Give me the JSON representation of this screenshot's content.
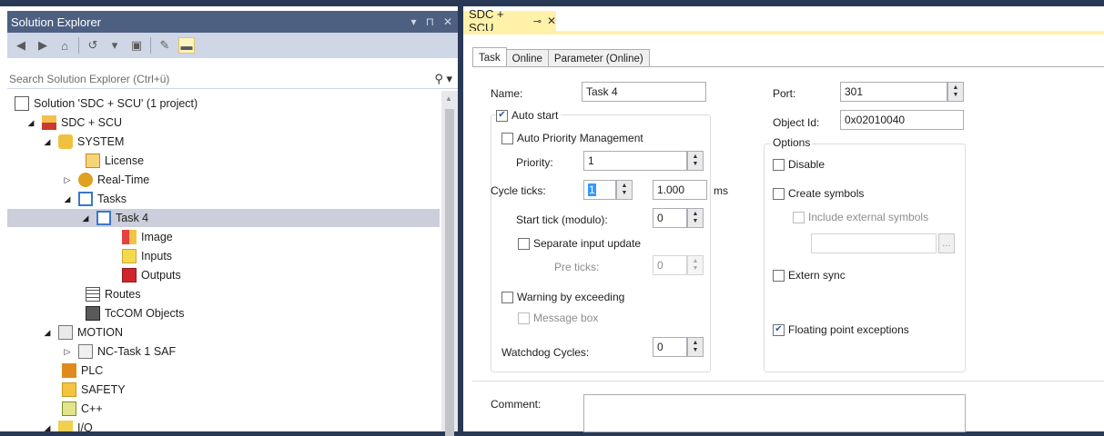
{
  "solution_explorer": {
    "title": "Solution Explorer",
    "title_controls": [
      "▾",
      "⊓",
      "✕"
    ],
    "search_placeholder": "Search Solution Explorer (Ctrl+ü)",
    "tree": {
      "solution": "Solution 'SDC + SCU' (1 project)",
      "project": "SDC + SCU",
      "system": "SYSTEM",
      "license": "License",
      "realtime": "Real-Time",
      "tasks": "Tasks",
      "task4": "Task 4",
      "image": "Image",
      "inputs": "Inputs",
      "outputs": "Outputs",
      "routes": "Routes",
      "tcom": "TcCOM Objects",
      "motion": "MOTION",
      "nctask": "NC-Task 1 SAF",
      "plc": "PLC",
      "safety": "SAFETY",
      "cpp": "C++",
      "io": "I/O"
    }
  },
  "document": {
    "tab_title": "SDC + SCU",
    "tabs": [
      "Task",
      "Online",
      "Parameter (Online)"
    ],
    "active_tab": "Task",
    "form": {
      "name_label": "Name:",
      "name_value": "Task 4",
      "auto_start": "Auto start",
      "auto_priority": "Auto Priority Management",
      "priority_label": "Priority:",
      "priority_value": "1",
      "cycle_ticks_label": "Cycle ticks:",
      "cycle_ticks_value": "1",
      "cycle_time_value": "1.000",
      "cycle_unit": "ms",
      "start_tick_label": "Start tick (modulo):",
      "start_tick_value": "0",
      "separate_input": "Separate input update",
      "pre_ticks_label": "Pre ticks:",
      "pre_ticks_value": "0",
      "warning_exceeding": "Warning by exceeding",
      "message_box": "Message box",
      "watchdog_label": "Watchdog Cycles:",
      "watchdog_value": "0",
      "port_label": "Port:",
      "port_value": "301",
      "object_id_label": "Object Id:",
      "object_id_value": "0x02010040",
      "options_title": "Options",
      "disable": "Disable",
      "create_symbols": "Create symbols",
      "include_external": "Include external symbols",
      "extern_sync": "Extern sync",
      "floating_point": "Floating point exceptions",
      "comment_label": "Comment:"
    }
  }
}
